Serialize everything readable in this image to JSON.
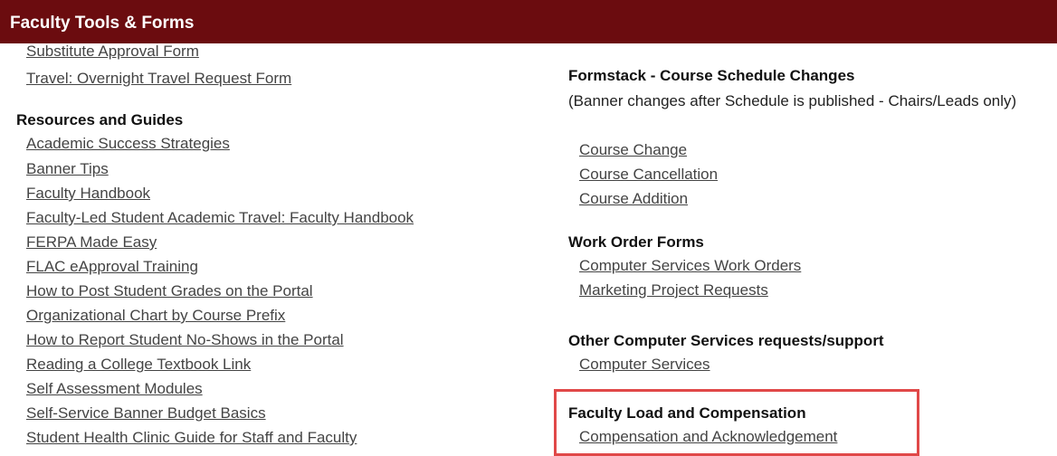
{
  "header": {
    "title": "Faculty Tools & Forms",
    "background_color": "#6b0c0f"
  },
  "left": {
    "top_links": [
      "Substitute Approval Form",
      "Travel: Overnight Travel Request Form"
    ],
    "resources": {
      "heading": "Resources and Guides",
      "links": [
        "Academic Success Strategies",
        "Banner Tips",
        "Faculty Handbook",
        "Faculty-Led Student Academic Travel: Faculty Handbook",
        "FERPA Made Easy",
        "FLAC eApproval Training",
        "How to Post Student Grades on the Portal",
        "Organizational Chart by Course Prefix",
        "How to Report Student No-Shows in the Portal",
        "Reading a College Textbook Link",
        "Self Assessment Modules",
        "Self-Service Banner Budget Basics",
        "Student Health Clinic Guide for Staff and Faculty"
      ]
    }
  },
  "right": {
    "formstack": {
      "heading": "Formstack - Course Schedule Changes",
      "description": "(Banner changes after Schedule is published - Chairs/Leads only)",
      "links": [
        "Course Change",
        "Course Cancellation",
        "Course Addition"
      ]
    },
    "work_orders": {
      "heading": "Work Order Forms",
      "links": [
        "Computer Services Work Orders",
        "Marketing Project Requests"
      ]
    },
    "other_services": {
      "heading": "Other Computer Services requests/support",
      "links": [
        "Computer Services"
      ]
    },
    "faculty_load": {
      "heading": "Faculty Load and Compensation",
      "links": [
        "Compensation and Acknowledgement"
      ],
      "highlight_color": "#e04848"
    }
  }
}
